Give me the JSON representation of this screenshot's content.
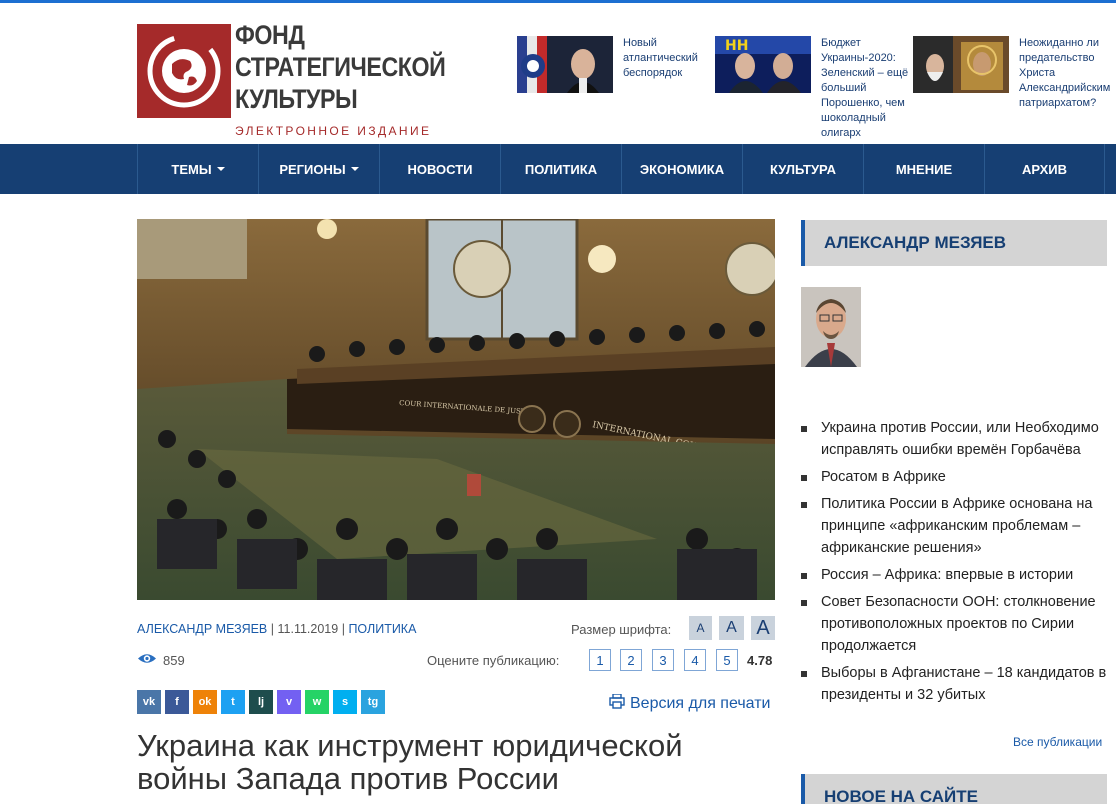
{
  "logo": {
    "line1": "ФОНД",
    "line2": "СТРАТЕГИЧЕСКОЙ",
    "line3": "КУЛЬТУРЫ",
    "subtitle": "ЭЛЕКТРОННОЕ ИЗДАНИЕ"
  },
  "header_news": [
    {
      "title": "Новый атлантический беспорядок"
    },
    {
      "title": "Бюджет Украины-2020: Зеленский – ещё больший Порошенко, чем шоколадный олигарх"
    },
    {
      "title": "Неожиданно ли предательство Христа Александрийским патриархатом?"
    }
  ],
  "nav": {
    "items": [
      {
        "label": "ТЕМЫ",
        "dropdown": true
      },
      {
        "label": "РЕГИОНЫ",
        "dropdown": true
      },
      {
        "label": "НОВОСТИ"
      },
      {
        "label": "ПОЛИТИКА"
      },
      {
        "label": "ЭКОНОМИКА"
      },
      {
        "label": "КУЛЬТУРА"
      },
      {
        "label": "МНЕНИЕ"
      },
      {
        "label": "АРХИВ"
      }
    ]
  },
  "article": {
    "author": "АЛЕКСАНДР МЕЗЯЕВ",
    "sep": "|",
    "date": "11.11.2019",
    "category": "ПОЛИТИКА",
    "font_size_label": "Размер шрифта:",
    "font_sizes": [
      "A",
      "A",
      "A"
    ],
    "views": "859",
    "rate_label": "Оцените публикацию:",
    "rate_options": [
      "1",
      "2",
      "3",
      "4",
      "5"
    ],
    "rating": "4.78",
    "print_label": "Версия для печати",
    "title": "Украина как инструмент юридической войны Запада против России",
    "hero_inscriptions": [
      "COUR INTERNATIONALE DE JUSTICE",
      "INTERNATIONAL COURT OF JUSTICE"
    ]
  },
  "share": [
    {
      "icon": "vk-icon",
      "glyph": "vk",
      "color": "#4a76a8"
    },
    {
      "icon": "facebook-icon",
      "glyph": "f",
      "color": "#3b5998"
    },
    {
      "icon": "odnoklassniki-icon",
      "glyph": "ok",
      "color": "#ee8208"
    },
    {
      "icon": "twitter-icon",
      "glyph": "t",
      "color": "#1da1f2"
    },
    {
      "icon": "livejournal-icon",
      "glyph": "lj",
      "color": "#1e4d4d"
    },
    {
      "icon": "viber-icon",
      "glyph": "v",
      "color": "#7360f2"
    },
    {
      "icon": "whatsapp-icon",
      "glyph": "w",
      "color": "#25d366"
    },
    {
      "icon": "skype-icon",
      "glyph": "s",
      "color": "#00aff0"
    },
    {
      "icon": "telegram-icon",
      "glyph": "tg",
      "color": "#2aa3df"
    }
  ],
  "sidebar": {
    "author_heading": "АЛЕКСАНДР МЕЗЯЕВ",
    "items": [
      "Украина против России, или Необходимо исправлять ошибки времён Горбачёва",
      "Росатом в Африке",
      "Политика России в Африке основана на принципе «африканским проблемам – африканские решения»",
      "Россия – Африка: впервые в истории",
      "Совет Безопасности ООН: столкновение противоположных проектов по Сирии продолжается",
      "Выборы в Афганистане – 18 кандидатов в президенты и 32 убитых"
    ],
    "all_link": "Все публикации",
    "new_heading": "НОВОЕ НА САЙТЕ"
  },
  "colors": {
    "nav_bg": "#163f73",
    "brand_red": "#a52a2a",
    "link": "#1a5aa8"
  }
}
